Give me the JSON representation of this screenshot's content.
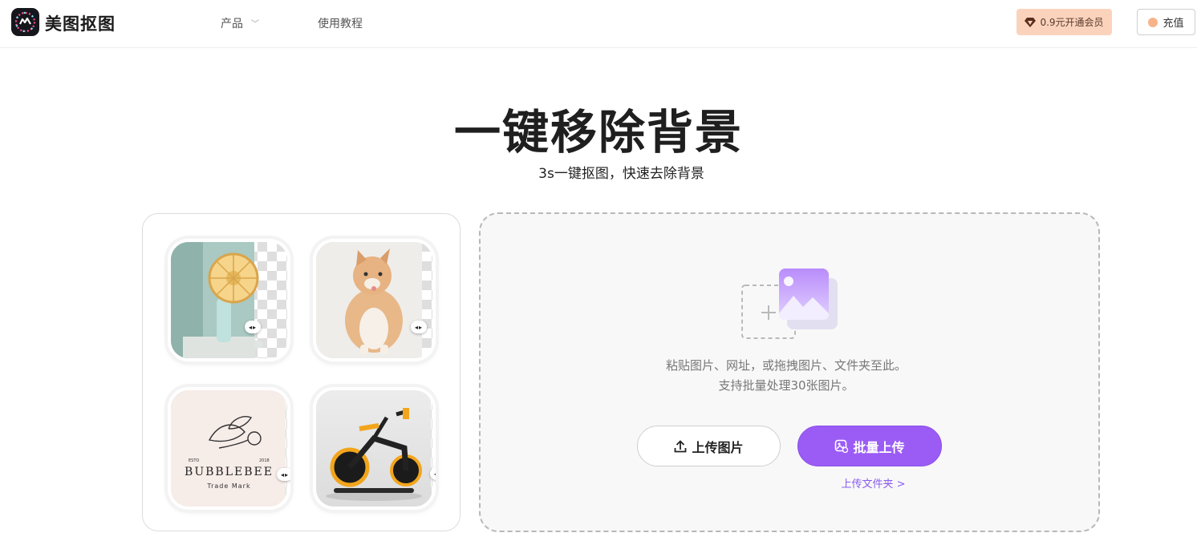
{
  "header": {
    "brand": "美图抠图",
    "nav": {
      "product": "产品",
      "tutorial": "使用教程"
    },
    "vip_button": "0.9元开通会员",
    "charge_button": "充值"
  },
  "hero": {
    "title": "一键移除背景",
    "subtitle": "3s一键抠图，快速去除背景"
  },
  "samples": {
    "logo_sample": {
      "top": "ESTO",
      "year": "2018",
      "name": "BUBBLEBEE",
      "sub": "Trade Mark"
    }
  },
  "upload": {
    "hint_line1": "粘贴图片、网址，或拖拽图片、文件夹至此。",
    "hint_line2": "支持批量处理30张图片。",
    "upload_button": "上传图片",
    "batch_button": "批量上传",
    "folder_link": "上传文件夹 >"
  },
  "colors": {
    "accent": "#9b5cf6",
    "vip_bg": "#fbd3bd"
  },
  "icons": [
    "app-logo-icon",
    "chevron-down-icon",
    "diamond-icon",
    "coin-icon",
    "upload-image-illustration",
    "upload-arrow-icon",
    "batch-images-icon"
  ]
}
